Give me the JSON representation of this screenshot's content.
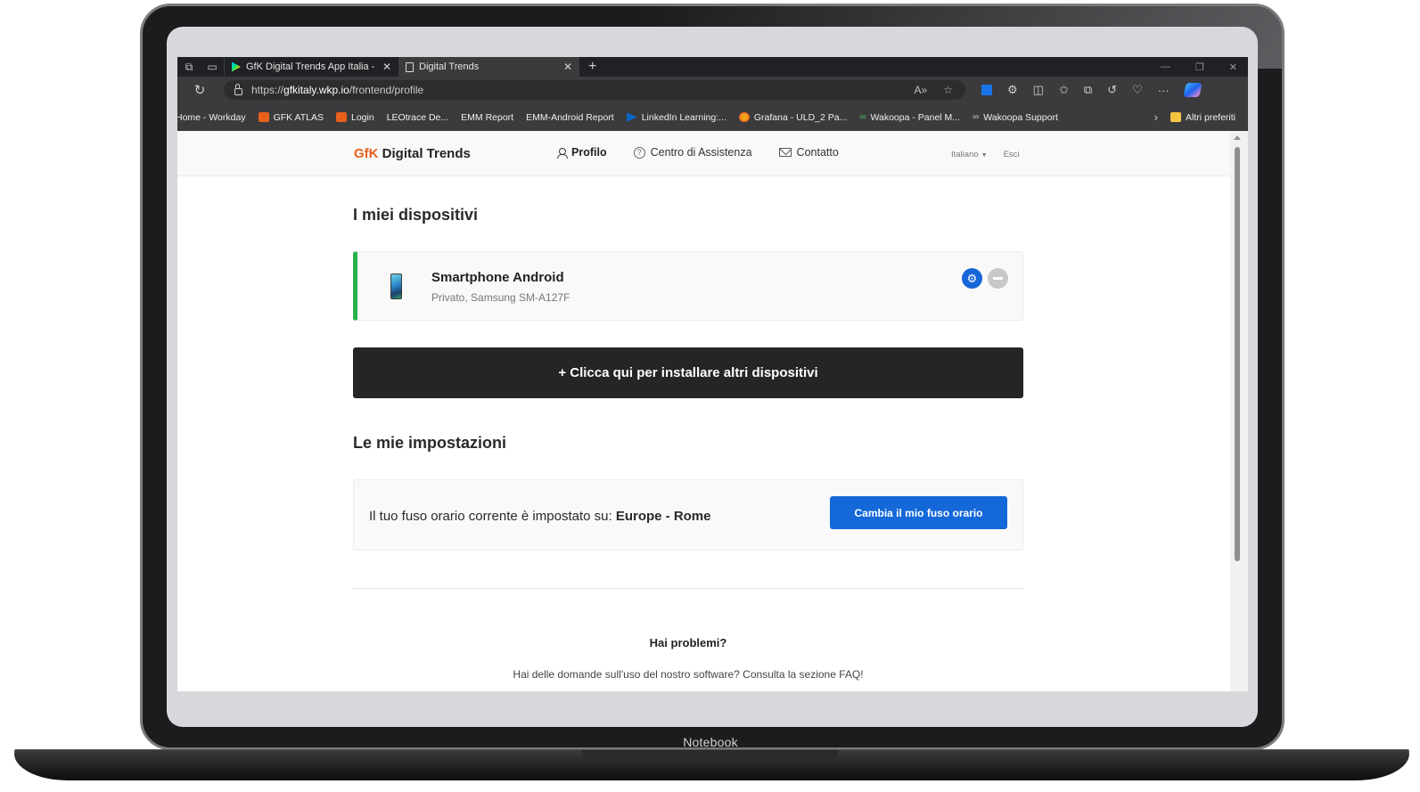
{
  "browser": {
    "tabs": [
      {
        "title": "GfK Digital Trends App Italia - Ap",
        "active": false
      },
      {
        "title": "Digital Trends",
        "active": true
      }
    ],
    "url_prefix": "https://",
    "url_domain": "gfkitaly.wkp.io",
    "url_path": "/frontend/profile",
    "bookmarks": [
      {
        "label": "Home - Workday",
        "icon": "none"
      },
      {
        "label": "GFK ATLAS",
        "icon": "gfk"
      },
      {
        "label": "Login",
        "icon": "gfk"
      },
      {
        "label": "LEOtrace De...",
        "icon": "none"
      },
      {
        "label": "EMM Report",
        "icon": "page"
      },
      {
        "label": "EMM-Android Report",
        "icon": "page"
      },
      {
        "label": "LinkedIn Learning:...",
        "icon": "linkedin"
      },
      {
        "label": "Grafana - ULD_2 Pa...",
        "icon": "grafana"
      },
      {
        "label": "Wakoopa - Panel M...",
        "icon": "wakoopa"
      },
      {
        "label": "Wakoopa Support",
        "icon": "wakoopa-grey"
      }
    ],
    "other_favorites": "Altri preferiti"
  },
  "site": {
    "logo_brand": "GfK",
    "logo_text": " Digital Trends",
    "nav": {
      "profile": "Profilo",
      "help_center": "Centro di Assistenza",
      "contact": "Contatto"
    },
    "language": "Italiano",
    "logout": "Esci"
  },
  "devices": {
    "heading": "I miei dispositivi",
    "items": [
      {
        "name": "Smartphone Android",
        "description": "Privato, Samsung SM-A127F",
        "status_color": "#27b24a"
      }
    ],
    "add_button": "+ Clicca qui per installare altri dispositivi"
  },
  "settings": {
    "heading": "Le mie impostazioni",
    "timezone_prefix": "Il tuo fuso orario corrente è impostato su: ",
    "timezone_value": "Europe - Rome",
    "change_button": "Cambia il mio fuso orario"
  },
  "help": {
    "title": "Hai problemi?",
    "subtitle": "Hai delle domande sull'uso del nostro software? Consulta la sezione FAQ!"
  },
  "device_frame": {
    "label": "Notebook"
  },
  "colors": {
    "accent_blue": "#1468d9",
    "device_status_green": "#27b24a",
    "gfk_orange": "#e8601c",
    "dark_button": "#252526"
  }
}
